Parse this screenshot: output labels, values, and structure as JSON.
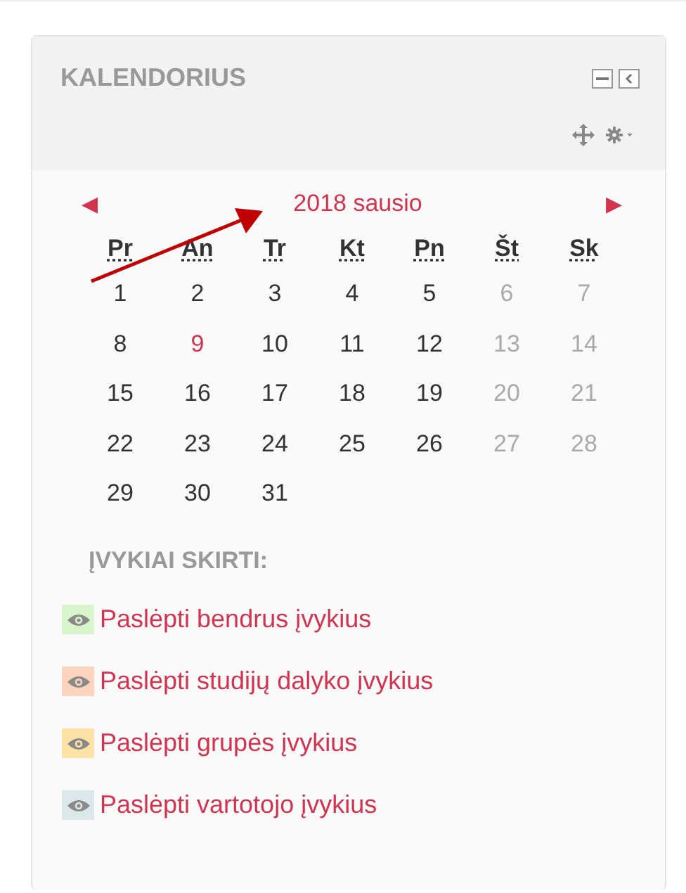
{
  "block": {
    "title": "KALENDORIUS"
  },
  "calendar": {
    "prev": "◀",
    "month": "2018 sausio",
    "next": "▶",
    "weekdays": [
      "Pr",
      "An",
      "Tr",
      "Kt",
      "Pn",
      "Št",
      "Sk"
    ],
    "weeks": [
      [
        {
          "label": "1",
          "weekend": false,
          "today": false
        },
        {
          "label": "2",
          "weekend": false,
          "today": false
        },
        {
          "label": "3",
          "weekend": false,
          "today": false
        },
        {
          "label": "4",
          "weekend": false,
          "today": false
        },
        {
          "label": "5",
          "weekend": false,
          "today": false
        },
        {
          "label": "6",
          "weekend": true,
          "today": false
        },
        {
          "label": "7",
          "weekend": true,
          "today": false
        }
      ],
      [
        {
          "label": "8",
          "weekend": false,
          "today": false
        },
        {
          "label": "9",
          "weekend": false,
          "today": true
        },
        {
          "label": "10",
          "weekend": false,
          "today": false
        },
        {
          "label": "11",
          "weekend": false,
          "today": false
        },
        {
          "label": "12",
          "weekend": false,
          "today": false
        },
        {
          "label": "13",
          "weekend": true,
          "today": false
        },
        {
          "label": "14",
          "weekend": true,
          "today": false
        }
      ],
      [
        {
          "label": "15",
          "weekend": false,
          "today": false
        },
        {
          "label": "16",
          "weekend": false,
          "today": false
        },
        {
          "label": "17",
          "weekend": false,
          "today": false
        },
        {
          "label": "18",
          "weekend": false,
          "today": false
        },
        {
          "label": "19",
          "weekend": false,
          "today": false
        },
        {
          "label": "20",
          "weekend": true,
          "today": false
        },
        {
          "label": "21",
          "weekend": true,
          "today": false
        }
      ],
      [
        {
          "label": "22",
          "weekend": false,
          "today": false
        },
        {
          "label": "23",
          "weekend": false,
          "today": false
        },
        {
          "label": "24",
          "weekend": false,
          "today": false
        },
        {
          "label": "25",
          "weekend": false,
          "today": false
        },
        {
          "label": "26",
          "weekend": false,
          "today": false
        },
        {
          "label": "27",
          "weekend": true,
          "today": false
        },
        {
          "label": "28",
          "weekend": true,
          "today": false
        }
      ],
      [
        {
          "label": "29",
          "weekend": false,
          "today": false
        },
        {
          "label": "30",
          "weekend": false,
          "today": false
        },
        {
          "label": "31",
          "weekend": false,
          "today": false
        }
      ]
    ]
  },
  "legend": {
    "heading": "ĮVYKIAI SKIRTI:",
    "items": [
      {
        "label": "Paslėpti bendrus įvykius",
        "color": "#d8f5cc"
      },
      {
        "label": "Paslėpti studijų dalyko įvykius",
        "color": "#ffd3bd"
      },
      {
        "label": "Paslėpti grupės įvykius",
        "color": "#ffe3a6"
      },
      {
        "label": "Paslėpti vartotojo įvykius",
        "color": "#dce7ec"
      }
    ]
  }
}
